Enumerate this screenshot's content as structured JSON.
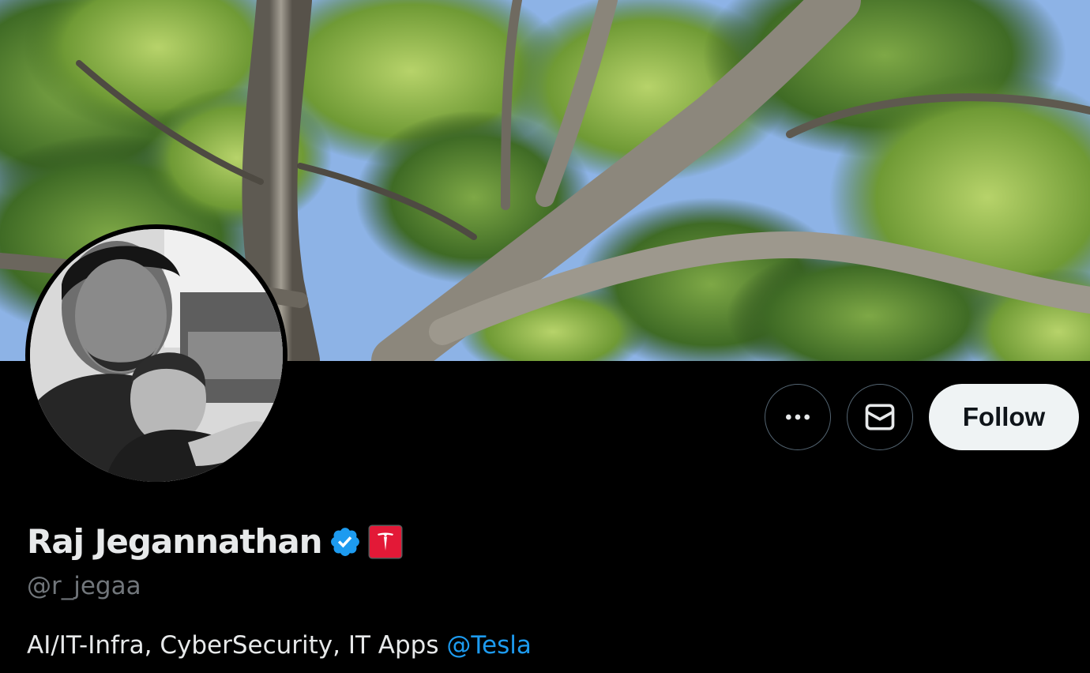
{
  "profile": {
    "display_name": "Raj Jegannathan",
    "handle": "@r_jegaa",
    "bio_text": "AI/IT-Infra, CyberSecurity, IT Apps ",
    "bio_mention": "@Tesla",
    "verified": true,
    "affiliate": "Tesla"
  },
  "actions": {
    "more_icon": "more-horizontal-icon",
    "message_icon": "envelope-icon",
    "follow_label": "Follow"
  },
  "colors": {
    "background": "#000000",
    "primary_text": "#e7e9ea",
    "secondary_text": "#71767b",
    "link": "#1d9bf0",
    "verified_badge": "#1d9bf0",
    "follow_button_bg": "#eff3f4",
    "affiliate_badge": "#e31937"
  }
}
